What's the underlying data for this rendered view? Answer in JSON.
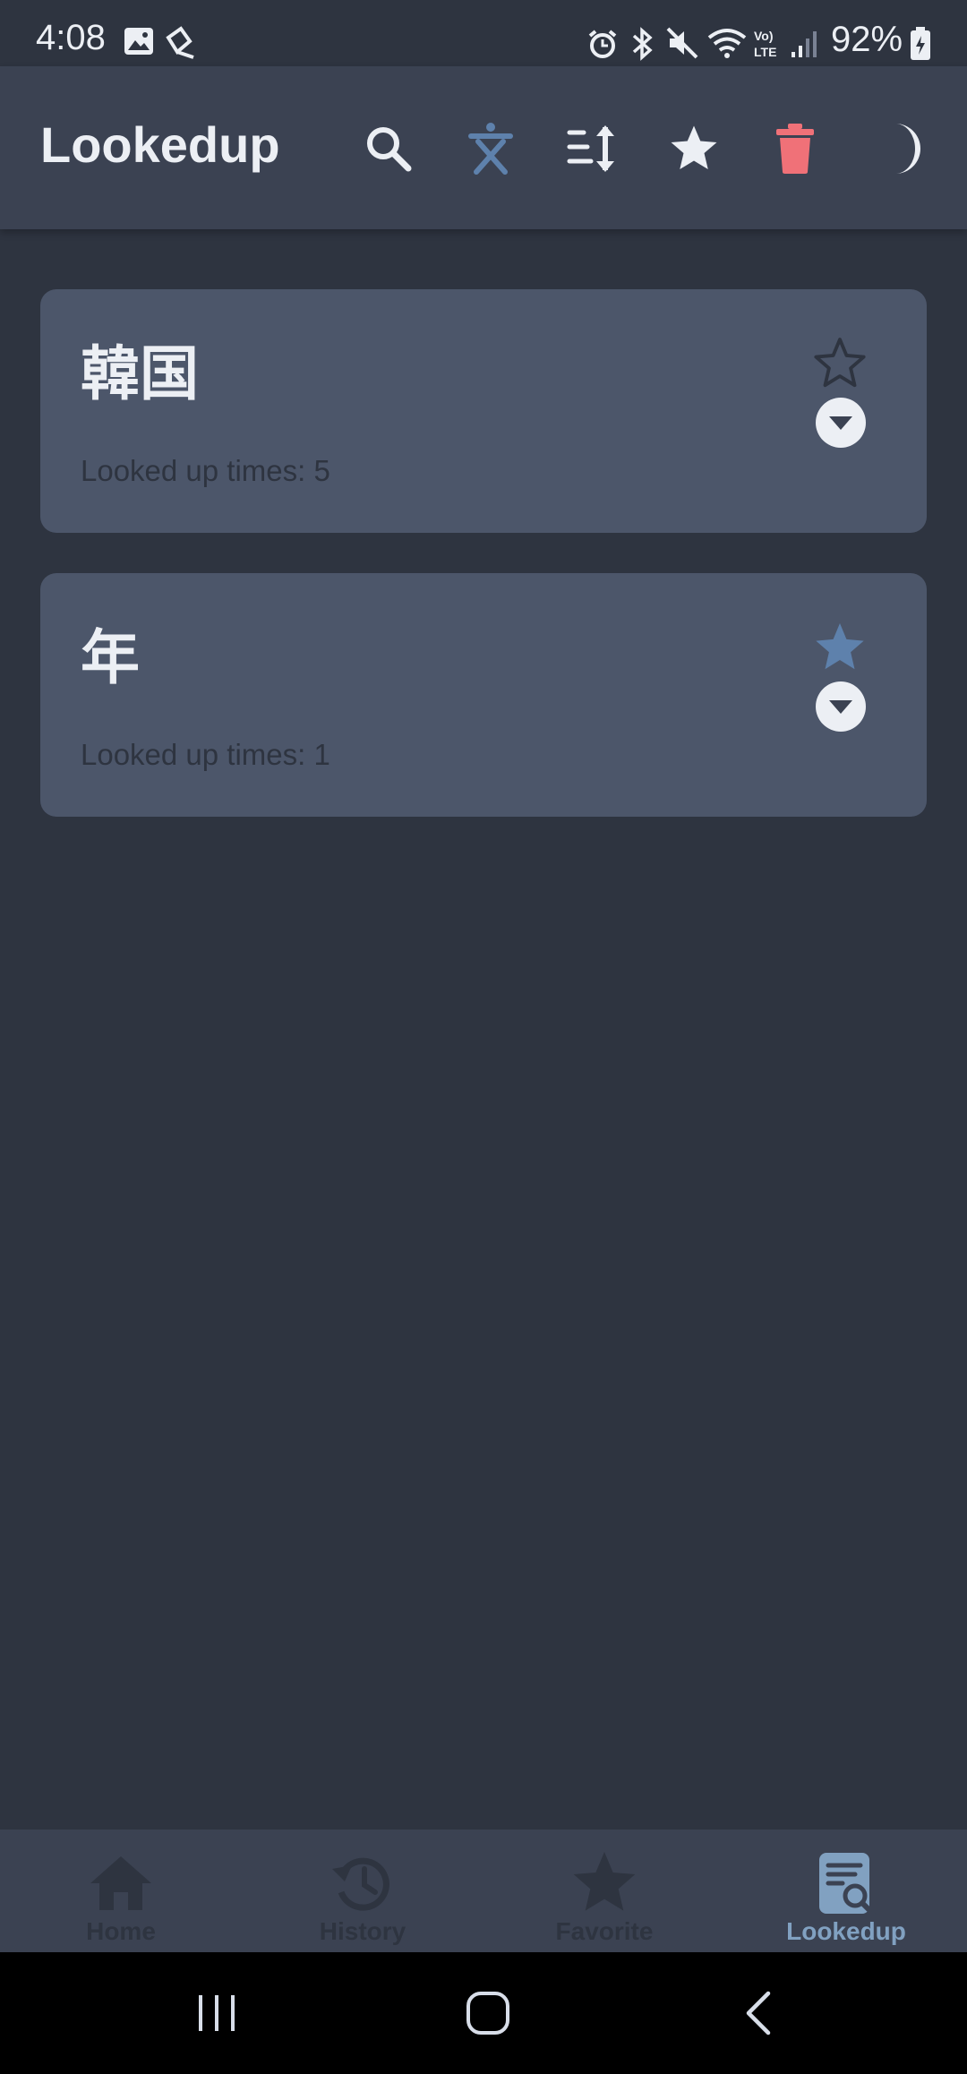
{
  "status_bar": {
    "time": "4:08",
    "battery": "92%"
  },
  "app_bar": {
    "title": "Lookedup",
    "actions": [
      {
        "icon": "search-icon"
      },
      {
        "icon": "chinese-character-icon",
        "color": "#5e81ac"
      },
      {
        "icon": "sort-icon"
      },
      {
        "icon": "star-icon"
      },
      {
        "icon": "trash-icon",
        "color": "#f07178"
      },
      {
        "icon": "moon-icon"
      }
    ]
  },
  "entries": [
    {
      "word": "韓国",
      "count_text": "Looked up times: 5",
      "favorite": false
    },
    {
      "word": "年",
      "count_text": "Looked up times: 1",
      "favorite": true
    }
  ],
  "bottom_nav": {
    "items": [
      {
        "label": "Home",
        "icon": "home-icon",
        "active": false
      },
      {
        "label": "History",
        "icon": "history-icon",
        "active": false
      },
      {
        "label": "Favorite",
        "icon": "star-icon",
        "active": false
      },
      {
        "label": "Lookedup",
        "icon": "lookup-icon",
        "active": true
      }
    ]
  },
  "colors": {
    "background": "#2e3440",
    "surface": "#3b4252",
    "card": "#4c566a",
    "accent": "#5e81ac",
    "danger": "#f07178",
    "text": "#eceff4"
  }
}
